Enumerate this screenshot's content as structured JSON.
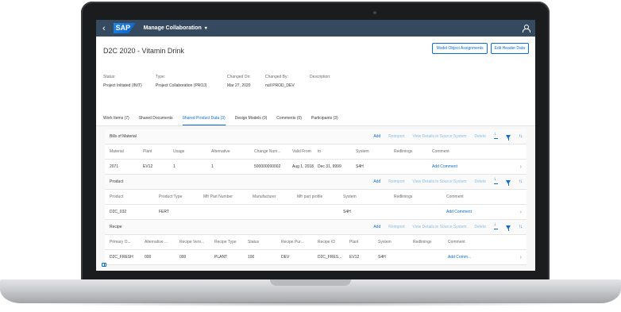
{
  "shell": {
    "back_glyph": "‹",
    "logo": "SAP",
    "app_title": "Manage Collaboration",
    "caret": "▾"
  },
  "header": {
    "title": "D2C 2020 - Vitamin Drink",
    "actions": {
      "model_assignments": "Model Object Assignments",
      "edit_header": "Edit Header Data"
    },
    "attributes": [
      {
        "label": "Status:",
        "value": "Project Initiated (INIT)"
      },
      {
        "label": "Type:",
        "value": "Project Collaboration (PROJ)"
      },
      {
        "label": "Changed On:",
        "value": "Mar 27, 2020"
      },
      {
        "label": "Changed By:",
        "value": "null PROD_DEV"
      },
      {
        "label": "Description:",
        "value": ""
      }
    ],
    "tabs": [
      {
        "label": "Work Items (7)"
      },
      {
        "label": "Shared Documents"
      },
      {
        "label": "Shared Product Data (3)"
      },
      {
        "label": "Design Models (0)"
      },
      {
        "label": "Comments (0)"
      },
      {
        "label": "Participants (3)"
      }
    ],
    "active_tab": "Shared Product Data (3)"
  },
  "sections": {
    "bom": {
      "title": "Bills of Material",
      "actions": {
        "add": "Add",
        "reimport": "Reimport",
        "view": "View Details in Source System",
        "delete": "Delete"
      },
      "columns": [
        "Material",
        "Plant",
        "Usage",
        "Alternative",
        "Change Num...",
        "Valid From",
        "to",
        "System",
        "Redlinings",
        "Comment"
      ],
      "rows": [
        {
          "material": "2071",
          "plant": "EV12",
          "usage": "1",
          "alternative": "1",
          "change_num": "500000000002",
          "valid_from": "Aug 1, 2018",
          "to": "Dec 31, 9999",
          "system": "S4H",
          "redlinings": "",
          "comment": "Add Comment"
        }
      ]
    },
    "product": {
      "title": "Product",
      "actions": {
        "add": "Add",
        "reimport": "Reimport",
        "view": "View Details in Source System",
        "delete": "Delete"
      },
      "columns": [
        "Product",
        "Product Type",
        "Mfr Part Number",
        "Manufacturer",
        "Mfr part profile",
        "System",
        "Redlinings",
        "Comment"
      ],
      "rows": [
        {
          "product": "D2C_032",
          "type": "FERT",
          "mfr_part": "",
          "manufacturer": "",
          "profile": "",
          "system": "S4H",
          "redlinings": "",
          "comment": "Add Comment"
        }
      ]
    },
    "recipe": {
      "title": "Recipe",
      "actions": {
        "add": "Add",
        "reimport": "Reimport",
        "view": "View Details in Source System",
        "delete": "Delete"
      },
      "columns": [
        "Primary O...",
        "Alternative ...",
        "Recipe Vers...",
        "Recipe Type",
        "Status",
        "Recipe Pur...",
        "Recipe ID",
        "Plant",
        "System",
        "Redlinings",
        "Comment"
      ],
      "rows": [
        {
          "primary": "D2C_FRESH",
          "alternative": "000",
          "version": "000",
          "type": "PLANT",
          "status": "100",
          "purpose": "DEV",
          "id": "D2C_FRES...",
          "plant": "EV12",
          "system": "S4H",
          "redlinings": "",
          "comment": "Add Comm..."
        }
      ]
    }
  },
  "icons": {
    "back": "chevron-left-icon",
    "user": "user-icon",
    "download": "download-icon",
    "filter": "filter-icon",
    "sort": "sort-icon",
    "row_nav": "chevron-right-icon",
    "side_panel": "side-panel-icon"
  },
  "colors": {
    "shellbar": "#354a5f",
    "accent": "#0a6ed1",
    "disabled_action": "#89bde6",
    "background": "#f7f7f7"
  }
}
